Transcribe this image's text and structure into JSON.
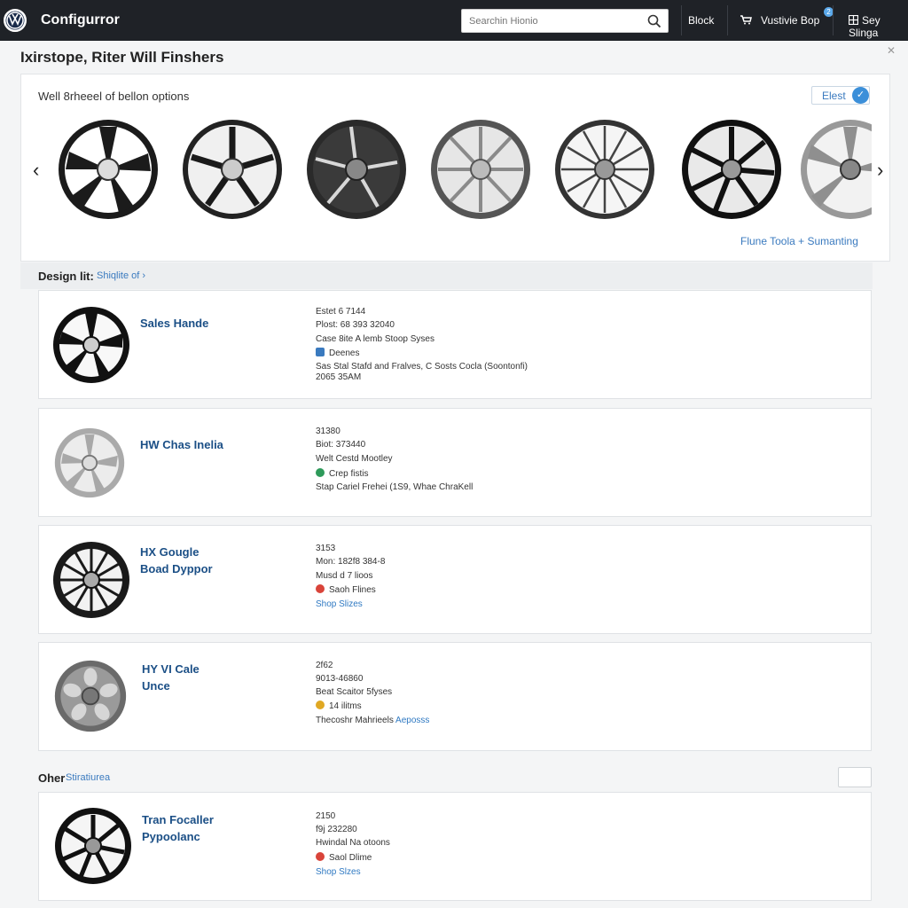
{
  "app": {
    "title": "Configurror",
    "logo": "vw-logo"
  },
  "search": {
    "placeholder": "Searchin Hionio"
  },
  "nav": {
    "item1": "Block",
    "item2": "Vustivie Bop",
    "item2_badge": "2",
    "item3": "Sey Slinga"
  },
  "page": {
    "heading": "Ixirstope, Riter Will Finshers"
  },
  "carousel": {
    "title": "Well 8rheeel of bellon options",
    "elect_label": "Elest",
    "link": "Flune Toola + Sumanting",
    "wheels": [
      {
        "style": "black-silver-5split"
      },
      {
        "style": "black-silver-10"
      },
      {
        "style": "dark-5double"
      },
      {
        "style": "silver-multispoke"
      },
      {
        "style": "silver-mesh"
      },
      {
        "style": "black-10"
      },
      {
        "style": "silver-5"
      }
    ]
  },
  "design_section": {
    "label": "Design lit:",
    "link": "Shiqlite of ›"
  },
  "rows": [
    {
      "name": "Sales Hande",
      "name2": "",
      "spec1": "Estet 6 7144",
      "spec2": "Plost: 68 393 32040",
      "spec3": "Case 8ite A lemb Stoop Syses",
      "spec4": "Deenes",
      "spec5": "Sas Stal Stafd and Fralves, C Sosts Cocla (Soontonfi)",
      "spec6": "2065 35AM",
      "dot_color": "#3a7abf"
    },
    {
      "name": "HW Chas Inelia",
      "name2": "",
      "spec1": "31380",
      "spec2": "Biot: 373440",
      "spec3": "Welt Cestd Mootley",
      "spec4": "Crep fistis",
      "spec5": "Stap Cariel Frehei (1S9, Whae ChraKell",
      "spec6": "",
      "dot_color": "#2e9a5a"
    },
    {
      "name": "HX Gougle",
      "name2": "Boad Dyppor",
      "spec1": "3153",
      "spec2": "Mon: 182f8 384-8",
      "spec3": "Musd d 7 lioos",
      "spec4": "Saoh Flines",
      "spec5": "Shop Slizes",
      "spec6": "",
      "dot_color": "#d9443a"
    },
    {
      "name": "HY VI Cale",
      "name2": "Unce",
      "spec1": "2f62",
      "spec2": "9013-46860",
      "spec3": "Beat Scaitor 5fyses",
      "spec4": "14 ilitms",
      "spec5": "Thecoshr Mahrieels",
      "spec5_link": "Aeposss",
      "spec6": "",
      "dot_color": "#e0a823"
    }
  ],
  "other_section": {
    "label": "Oher",
    "link": "Stiratiurea"
  },
  "other_row": {
    "name": "Tran Focaller",
    "name2": "Pypoolanc",
    "spec1": "2150",
    "spec2": "f9j 232280",
    "spec3": "Hwindal Na otoons",
    "spec4": "Saol Dlime",
    "spec5": "Shop Slzes",
    "dot_color": "#d9443a"
  },
  "colors": {
    "topbar": "#1f2227",
    "accent": "#3a7abf",
    "name_blue": "#1b4f86"
  }
}
